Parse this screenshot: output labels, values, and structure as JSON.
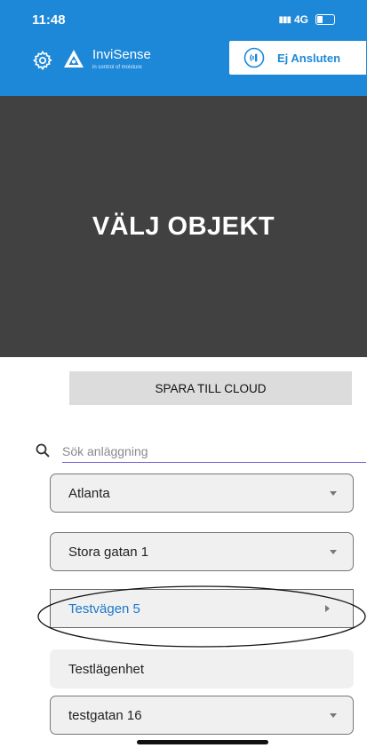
{
  "status_bar": {
    "time": "11:48",
    "network": "4G"
  },
  "header": {
    "settings_icon": "gear-icon",
    "brand_name": "InviSense",
    "brand_tagline": "in control of moisture",
    "connection_label": "Ej Ansluten",
    "connection_icon": "nfc-signal-icon",
    "accent_color": "#1e88d8"
  },
  "hero": {
    "title": "VÄLJ OBJEKT",
    "background": "#414141"
  },
  "actions": {
    "save_label": "SPARA TILL CLOUD"
  },
  "search": {
    "placeholder": "Sök anläggning",
    "value": ""
  },
  "objects": [
    {
      "label": "Atlanta",
      "indicator": "chevron-down",
      "state": "default"
    },
    {
      "label": "Stora gatan 1",
      "indicator": "chevron-down",
      "state": "default"
    },
    {
      "label": "Testvägen 5",
      "indicator": "chevron-right",
      "state": "selected"
    },
    {
      "label": "Testlägenhet",
      "indicator": "none",
      "state": "default"
    },
    {
      "label": "testgatan 16",
      "indicator": "chevron-down",
      "state": "default"
    }
  ]
}
